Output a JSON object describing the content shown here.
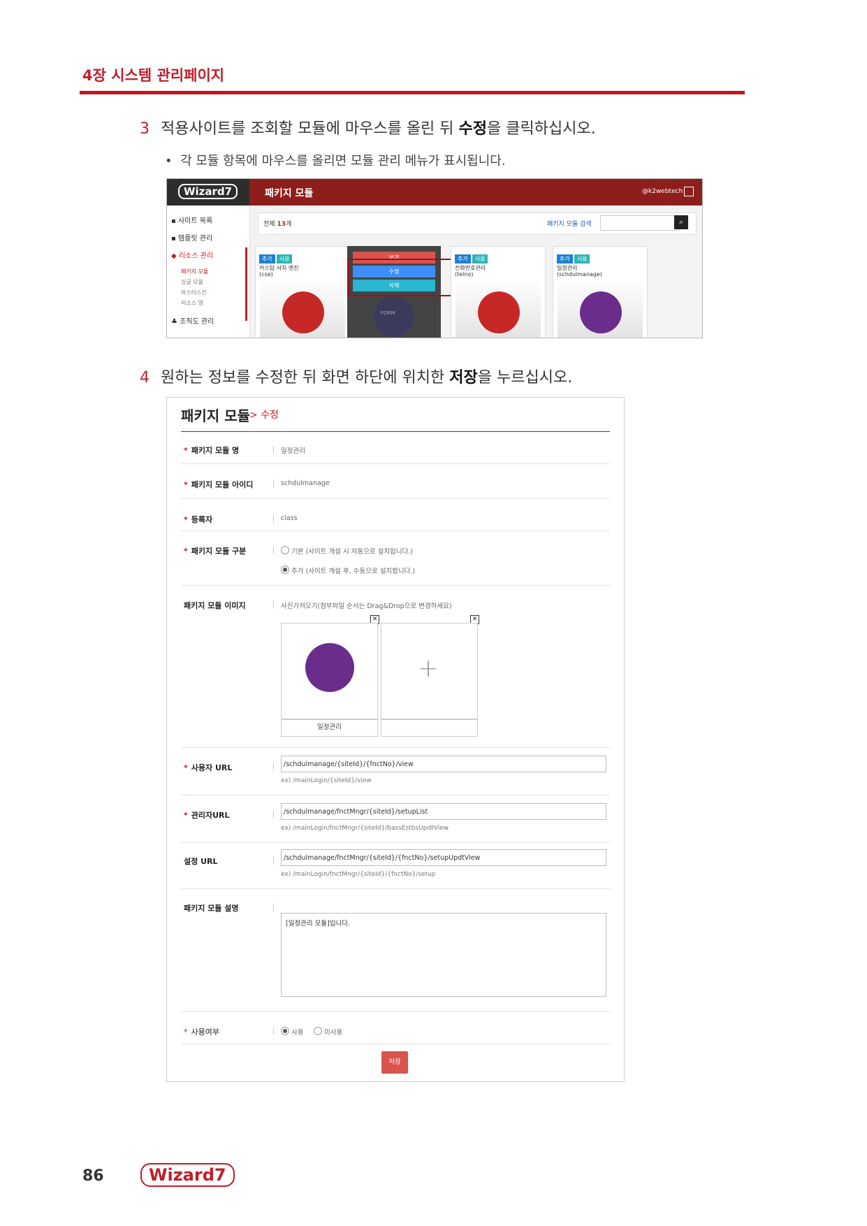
{
  "chapter": "4장 시스템 관리페이지",
  "step3": {
    "num": "3",
    "pre": "적용사이트를 조회할 모듈에 마우스를 올린 뒤 ",
    "bold": "수정",
    "post": "을 클릭하십시오."
  },
  "step3_bullet": "각 모듈 항목에 마우스를 올리면 모듈 관리 메뉴가 표시됩니다.",
  "step4": {
    "num": "4",
    "pre": "원하는 정보를 수정한 뒤 화면 하단에 위치한 ",
    "bold": "저장",
    "post": "을 누르십시오."
  },
  "shot1": {
    "logo": "Wizard7",
    "title": "패키지 모듈",
    "user": "@k2webtech",
    "sidebar": {
      "site_list": "사이트 목록",
      "template": "템플릿 관리",
      "resource": "리소스 관리",
      "sub1": "패키지 모듈",
      "sub2": "싱글 모듈",
      "sub3": "마스터스킨",
      "sub4": "리소스 영",
      "org": "조직도 관리"
    },
    "total_label": "전체",
    "total_count": "13",
    "total_unit": "개",
    "search_label": "패키지 모듈 검색",
    "tag_add": "추가",
    "tag_use": "사용",
    "cards": [
      {
        "name": "커스텀 서치 엔진",
        "id": "(cse)",
        "color": "#c62828"
      },
      {
        "name": "전화번호관리",
        "id": "(telno)",
        "color": "#c62828"
      },
      {
        "name": "일정관리",
        "id": "(schdulmanage)",
        "color": "#6a2d8c"
      }
    ],
    "overlay": {
      "btn_view": "보기",
      "btn_edit": "수정",
      "btn_delete": "삭제",
      "form_text": "FORM"
    }
  },
  "form": {
    "title": "패키지 모듈",
    "crumb": "> 수정",
    "required_mark": "*",
    "name_label": "패키지 모듈 명",
    "name_value": "일정관리",
    "id_label": "패키지 모듈 아이디",
    "id_value": "schdulmanage",
    "author_label": "등록자",
    "author_value": "class",
    "type_label": "패키지 모듈 구분",
    "type_opt1": "기본 (사이트 개설 시 자동으로 설치됩니다.)",
    "type_opt2": "추가 (사이트 개설 후, 수동으로 설치합니다.)",
    "image_label": "패키지 모듈 이미지",
    "image_hint": "사진가져오기(첨부파일 순서는 Drag&Drop으로 변경하세요)",
    "image_caption": "일정관리",
    "close_x": "✕",
    "plus": "+",
    "user_url_label": "사용자 URL",
    "user_url_value": "/schdulmanage/{siteId}/{fnctNo}/view",
    "user_url_hint": "ex) /mainLogin/{siteId}/view",
    "admin_url_label": "관리자URL",
    "admin_url_value": "/schdulmanage/fnctMngr/{siteId}/setupList",
    "admin_url_hint": "ex) /mainLogin/fnctMngr/{siteId}/bassEstbsUpdtView",
    "setup_url_label": "설정 URL",
    "setup_url_value": "/schdulmanage/fnctMngr/{siteId}/{fnctNo}/setupUpdtView",
    "setup_url_hint": "ex) /mainLogin/fnctMngr/{siteId}/{fnctNo}/setup",
    "desc_label": "패키지 모듈 설명",
    "desc_value": "[일정관리 모듈]입니다.",
    "use_label": "사용여부",
    "use_yes": "사용",
    "use_no": "미사용",
    "save": "저장"
  },
  "footer": {
    "page": "86",
    "logo": "Wizard7"
  }
}
